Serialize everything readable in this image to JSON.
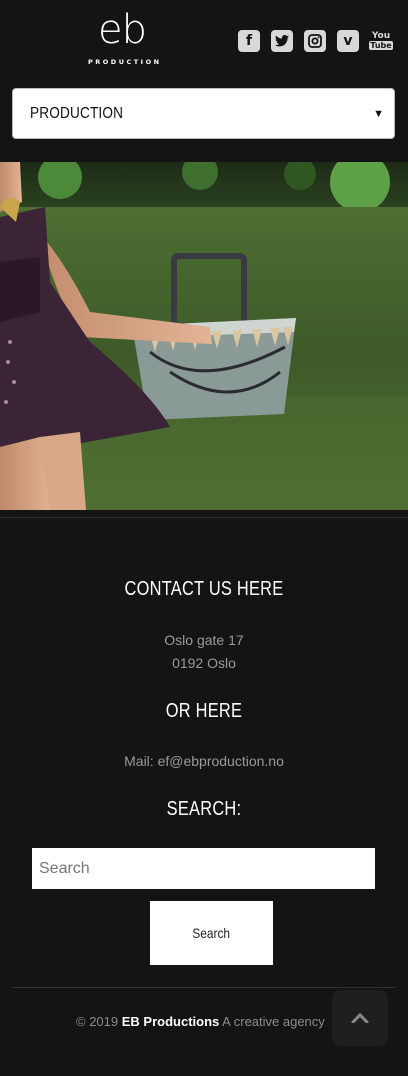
{
  "header": {
    "logo_mark": "eb",
    "logo_sub": "PRODUCTION",
    "social": [
      {
        "icon": "facebook-icon",
        "glyph": "f"
      },
      {
        "icon": "twitter-icon",
        "glyph": "t"
      },
      {
        "icon": "instagram-icon",
        "glyph": "◎"
      },
      {
        "icon": "vimeo-icon",
        "glyph": "v"
      },
      {
        "icon": "youtube-icon",
        "glyph_top": "You",
        "glyph_bottom": "Tube"
      }
    ]
  },
  "nav_select": {
    "selected": "PRODUCTION"
  },
  "contact": {
    "heading": "CONTACT US HERE",
    "address_line1": "Oslo gate 17",
    "address_line2": "0192 Oslo",
    "or_heading": "OR HERE",
    "mail": "Mail: ef@ebproduction.no"
  },
  "search": {
    "heading": "SEARCH:",
    "placeholder": "Search",
    "button_label": "Search"
  },
  "footer": {
    "copyright": "© 2019",
    "brand": "EB Productions",
    "tagline": "A creative agency"
  },
  "colors": {
    "background": "#141414",
    "text_muted": "#9a9a9a"
  }
}
